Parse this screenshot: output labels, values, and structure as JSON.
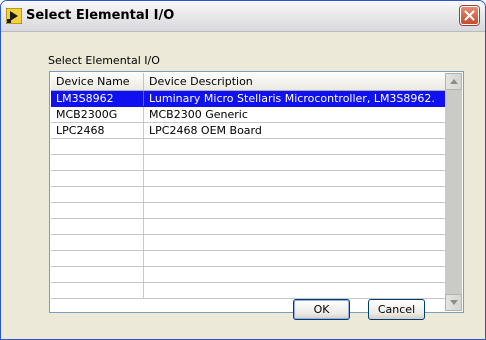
{
  "window": {
    "title": "Select Elemental I/O"
  },
  "dialog": {
    "group_label": "Select Elemental I/O",
    "columns": [
      "Device Name",
      "Device Description"
    ],
    "rows": [
      {
        "name": "LM3S8962",
        "description": "Luminary Micro Stellaris Microcontroller, LM3S8962.",
        "selected": true
      },
      {
        "name": "MCB2300G",
        "description": "MCB2300 Generic",
        "selected": false
      },
      {
        "name": "LPC2468",
        "description": "LPC2468 OEM Board",
        "selected": false
      }
    ],
    "empty_rows": 10,
    "ok_label": "OK",
    "cancel_label": "Cancel"
  },
  "colors": {
    "selection": "#1010f0",
    "dialog_bg": "#ece9d8",
    "close_button": "#c44c2e"
  },
  "icons": [
    "labview-icon",
    "close-icon",
    "scroll-up-icon",
    "scroll-down-icon"
  ]
}
